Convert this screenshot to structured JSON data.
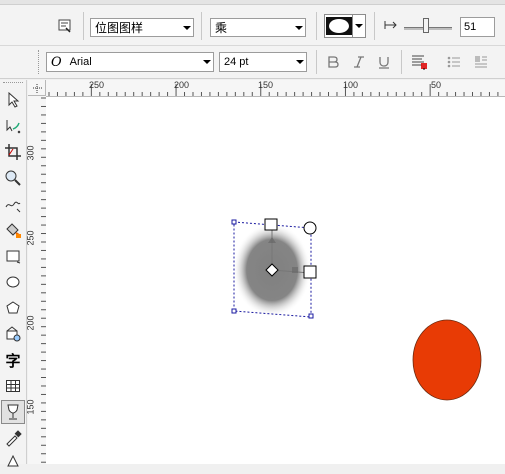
{
  "property_bar": {
    "bitmap_pattern_select": "位图图样",
    "merge_mode_select": "乘",
    "transparency_value": "51"
  },
  "text_bar": {
    "font_name": "Arial",
    "font_size": "24 pt"
  },
  "ruler_top": {
    "labels": [
      "250",
      "200",
      "150",
      "100",
      "50"
    ]
  },
  "ruler_left": {
    "labels": [
      "300",
      "250",
      "200",
      "150"
    ]
  },
  "toolbox": {
    "text_tool_glyph": "字"
  },
  "colors": {
    "red_ellipse": "#e83b05",
    "gray_ellipse": "#808080",
    "selection_frame": "#1a1aa0"
  }
}
